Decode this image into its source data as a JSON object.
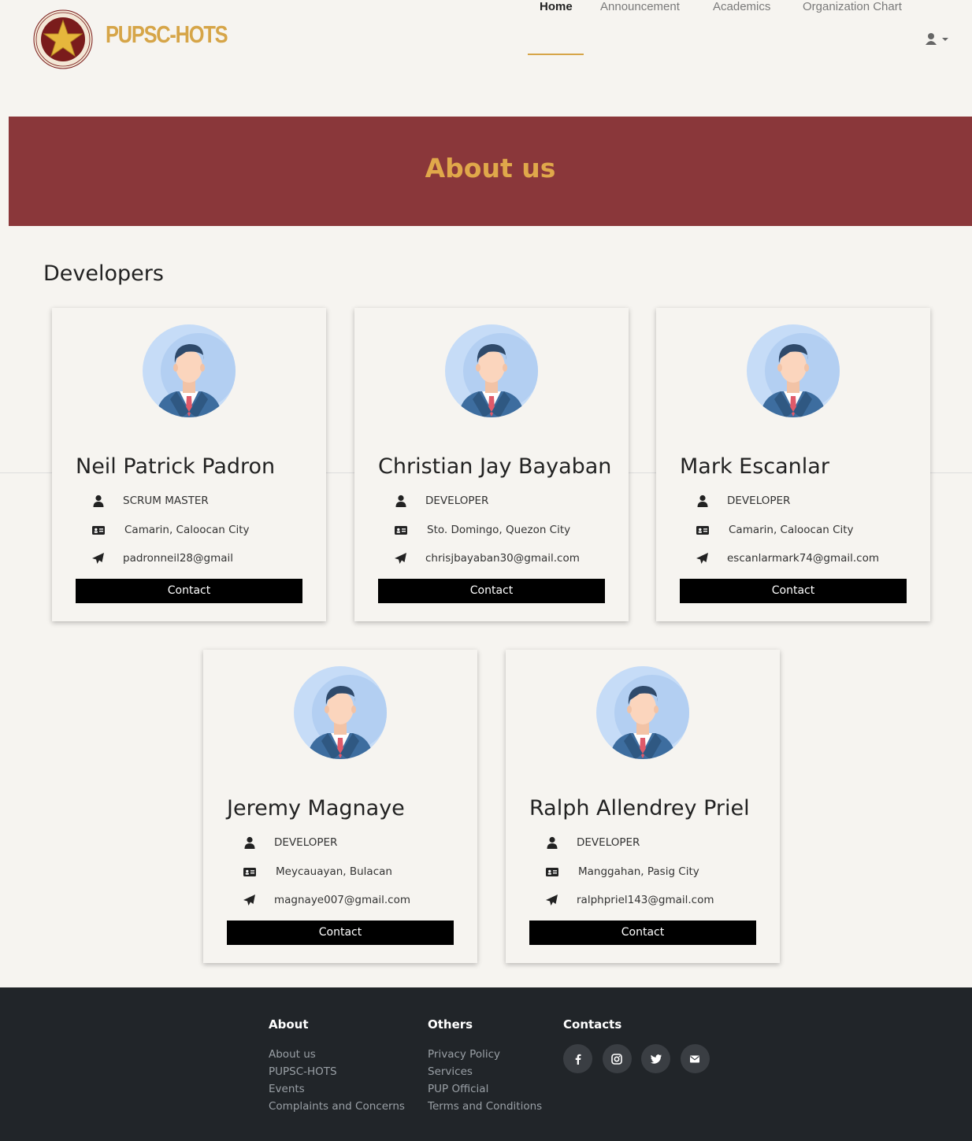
{
  "brand": {
    "name": "PUPSC-HOTS",
    "seal_text": "POLYTECHNIC UNIVERSITY OF THE PHILIPPINES",
    "seal_year": "1904"
  },
  "nav": {
    "links": [
      "Home",
      "Announcement",
      "Academics",
      "Organization Chart"
    ],
    "active": "Home",
    "user_icon": "user-icon",
    "caret_icon": "caret-down-icon"
  },
  "banner": {
    "title": "About us"
  },
  "section": {
    "title": "Developers"
  },
  "developers": [
    {
      "name": "Neil Patrick Padron",
      "role": "SCRUM MASTER",
      "address": "Camarin, Caloocan City",
      "email": "padronneil28@gmail",
      "button": "Contact"
    },
    {
      "name": "Christian Jay Bayaban",
      "role": "DEVELOPER",
      "address": "Sto. Domingo, Quezon City",
      "email": "chrisjbayaban30@gmail.com",
      "button": "Contact"
    },
    {
      "name": "Mark Escanlar",
      "role": "DEVELOPER",
      "address": "Camarin, Caloocan City",
      "email": "escanlarmark74@gmail.com",
      "button": "Contact"
    },
    {
      "name": "Jeremy Magnaye",
      "role": "DEVELOPER",
      "address": "Meycauayan, Bulacan",
      "email": "magnaye007@gmail.com",
      "button": "Contact"
    },
    {
      "name": "Ralph Allendrey Priel",
      "role": "DEVELOPER",
      "address": "Manggahan, Pasig City",
      "email": "ralphpriel143@gmail.com",
      "button": "Contact"
    }
  ],
  "footer": {
    "about": {
      "heading": "About",
      "links": [
        "About us",
        "PUPSC-HOTS",
        "Events",
        "Complaints and Concerns"
      ]
    },
    "others": {
      "heading": "Others",
      "links": [
        "Privacy Policy",
        "Services",
        "PUP Official",
        "Terms and Conditions"
      ]
    },
    "contacts": {
      "heading": "Contacts",
      "icons": [
        "facebook-icon",
        "instagram-icon",
        "twitter-icon",
        "envelope-icon"
      ]
    }
  },
  "colors": {
    "maroon": "#8a373a",
    "gold": "#d6a548",
    "footer_bg": "#212529",
    "page_bg": "#f6f4f0"
  }
}
